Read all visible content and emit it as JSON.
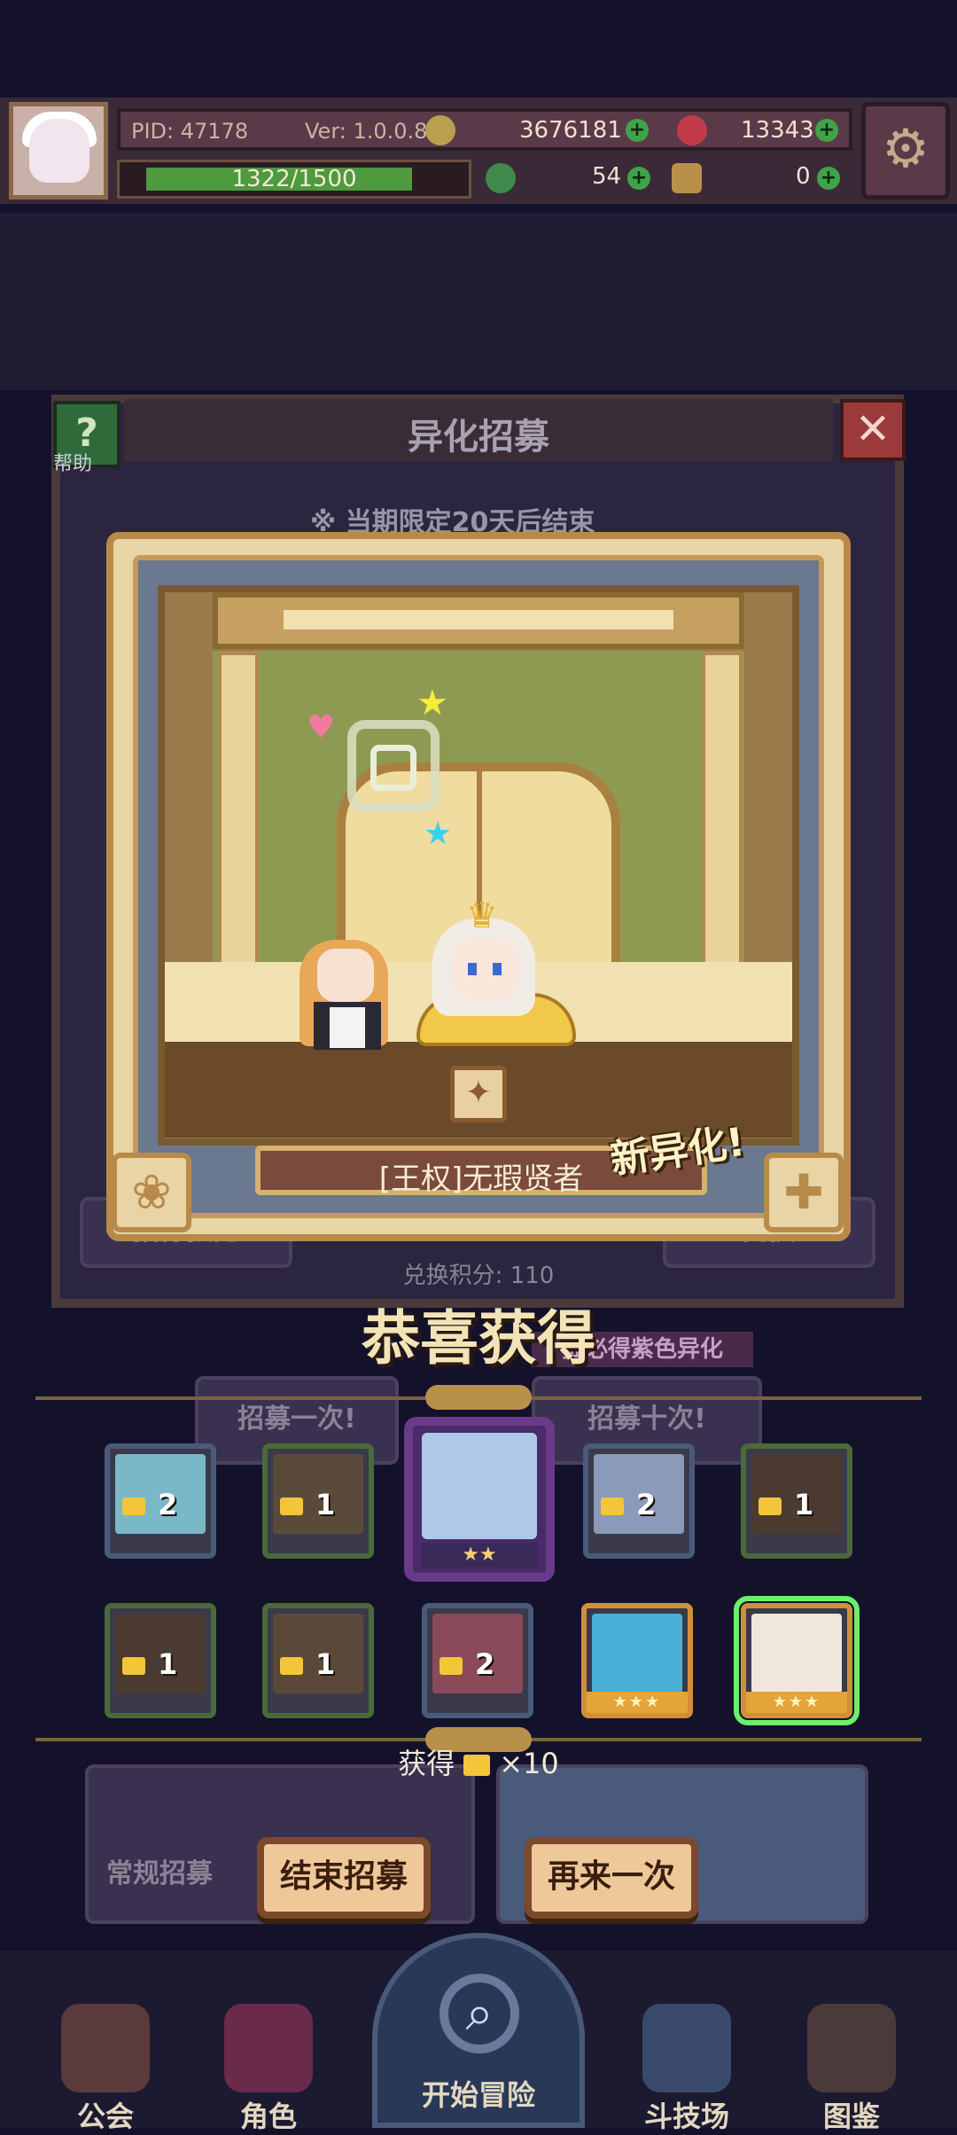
{
  "topbar": {
    "pid": "PID: 47178",
    "version": "Ver: 1.0.0.8",
    "gold": "3676181",
    "gems": "13343",
    "exp": "1322/1500",
    "exp_fraction": 0.881,
    "clover": "54",
    "item": "0"
  },
  "background": {
    "panel_title": "异化招募",
    "help_label": "帮助",
    "limit_notice": "※ 当期限定20天后结束",
    "points": "兑换积分: 110",
    "purple_banner": "抽必得紫色异化",
    "recruit_once": "招募一次!",
    "recruit_ten": "招募十次!",
    "regular_recruit": "常规招募",
    "preview": "招募预览",
    "exchange": "兑换"
  },
  "card": {
    "character_name": "[王权]无瑕贤者",
    "new_label": "新异化!"
  },
  "congrats": "恭喜获得",
  "featured": {
    "stars": "★★"
  },
  "rewards_row1": [
    {
      "count": "2",
      "color": "#7ab8c8",
      "frame": "blue"
    },
    {
      "count": "1",
      "color": "#5a4a3a",
      "frame": "green"
    },
    {
      "count": "2",
      "color": "#8a9ab8",
      "frame": "blue"
    },
    {
      "count": "1",
      "color": "#4a3a30",
      "frame": "green"
    }
  ],
  "rewards_row2": [
    {
      "count": "1",
      "color": "#4a3a30",
      "frame": "green"
    },
    {
      "count": "1",
      "color": "#5a4838",
      "frame": "green"
    },
    {
      "count": "2",
      "color": "#8a4a5a",
      "frame": "blue"
    }
  ],
  "gold_cards": [
    {
      "stars": "★★★",
      "color": "#4ab0d8"
    },
    {
      "stars": "★★★",
      "color": "#f1e6dc"
    }
  ],
  "obtain": {
    "prefix": "获得",
    "suffix": "×10"
  },
  "buttons": {
    "end": "结束招募",
    "again": "再来一次"
  },
  "nav": {
    "guild": "公会",
    "character": "角色",
    "start": "开始冒险",
    "arena": "斗技场",
    "codex": "图鉴"
  },
  "colors": {
    "accent": "#efc89a",
    "frame": "#b88a4a"
  }
}
